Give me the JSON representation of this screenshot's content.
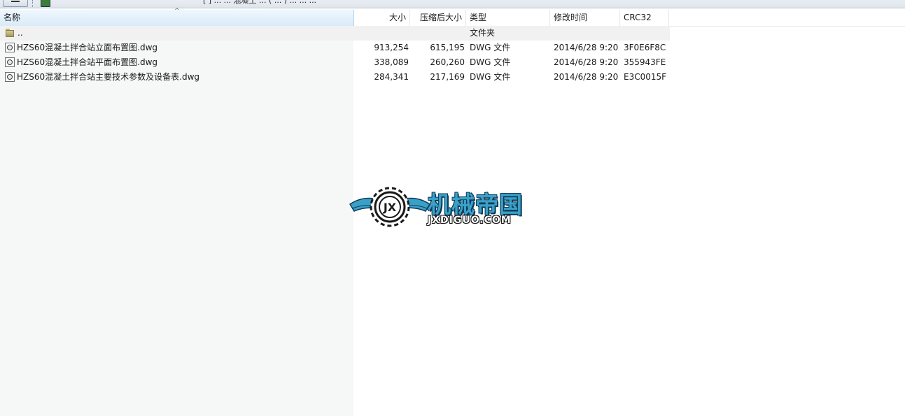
{
  "toolbar": {
    "path_text": "[ ] ... ... 混凝土 ... ( ... ) ... ... ..."
  },
  "columns": {
    "name": "名称",
    "size": "大小",
    "packed": "压缩后大小",
    "type": "类型",
    "modified": "修改时间",
    "crc": "CRC32"
  },
  "sort_arrow": "^",
  "files": [
    {
      "name": "..",
      "size": "",
      "packed": "",
      "type": "文件夹",
      "modified": "",
      "crc": "",
      "icon": "folder-icon"
    },
    {
      "name": "HZS60混凝土拌合站立面布置图.dwg",
      "size": "913,254",
      "packed": "615,195",
      "type": "DWG 文件",
      "modified": "2014/6/28 9:20",
      "crc": "3F0E6F8C",
      "icon": "dwg-file-icon"
    },
    {
      "name": "HZS60混凝土拌合站平面布置图.dwg",
      "size": "338,089",
      "packed": "260,260",
      "type": "DWG 文件",
      "modified": "2014/6/28 9:20",
      "crc": "355943FE",
      "icon": "dwg-file-icon"
    },
    {
      "name": "HZS60混凝土拌合站主要技术参数及设备表.dwg",
      "size": "284,341",
      "packed": "217,169",
      "type": "DWG 文件",
      "modified": "2014/6/28 9:20",
      "crc": "E3C0015F",
      "icon": "dwg-file-icon"
    }
  ],
  "watermark": {
    "emblem_text": "JX",
    "title": "机械帝国",
    "domain": "JXDIGUO.COM"
  },
  "colors": {
    "header_sorted_bg": "#d9ebfa",
    "watermark_blue": "#3aa0c8",
    "watermark_outline": "#0e3b57",
    "name_column_bg": "#f6f7f7"
  }
}
